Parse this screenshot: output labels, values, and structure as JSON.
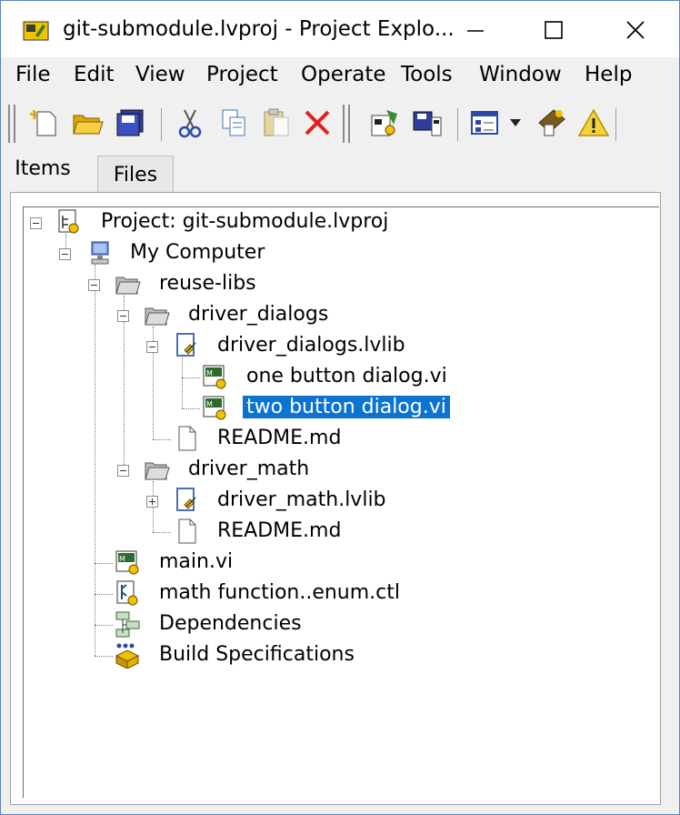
{
  "window": {
    "title": "git-submodule.lvproj - Project Explo...",
    "controls": [
      "minimize",
      "maximize",
      "close"
    ]
  },
  "menu": [
    "File",
    "Edit",
    "View",
    "Project",
    "Operate",
    "Tools",
    "Window",
    "Help"
  ],
  "toolbar": {
    "icons": [
      "new-icon",
      "open-icon",
      "save-all-icon",
      "cut-icon",
      "copy-icon",
      "paste-icon",
      "delete-icon",
      "build-icon",
      "deploy-icon",
      "view-options-icon",
      "show-hide-icon",
      "warning-icon"
    ]
  },
  "tabs": [
    {
      "label": "Items",
      "active": true
    },
    {
      "label": "Files",
      "active": false
    }
  ],
  "tree": {
    "project": "Project: git-submodule.lvproj",
    "my_computer": "My Computer",
    "reuse_libs": "reuse-libs",
    "driver_dialogs": "driver_dialogs",
    "driver_dialogs_lib": "driver_dialogs.lvlib",
    "one_button": "one button dialog.vi",
    "two_button": "two button dialog.vi",
    "readme_1": "README.md",
    "driver_math": "driver_math",
    "driver_math_lib": "driver_math.lvlib",
    "readme_2": "README.md",
    "main_vi": "main.vi",
    "math_enum": "math function..enum.ctl",
    "dependencies": "Dependencies",
    "build_specs": "Build Specifications",
    "selected": "two_button"
  },
  "colors": {
    "selection": "#0c74d0",
    "window_border": "#5a86c8",
    "folder": "#c8c8c8",
    "lib_icon": "#4a6fb5"
  }
}
